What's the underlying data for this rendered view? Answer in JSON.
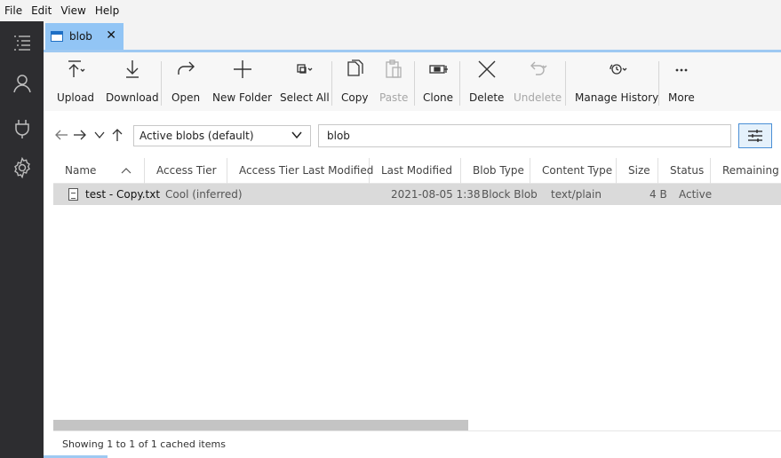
{
  "menu": [
    "File",
    "Edit",
    "View",
    "Help"
  ],
  "activity_bar": {
    "items": [
      {
        "icon": "explorer-list-icon"
      },
      {
        "icon": "account-icon"
      },
      {
        "icon": "connect-plug-icon"
      },
      {
        "icon": "settings-gear-icon"
      }
    ]
  },
  "tab": {
    "label": "blob",
    "close": "✕"
  },
  "toolbar": {
    "upload": "Upload",
    "download": "Download",
    "open": "Open",
    "new_folder": "New Folder",
    "select_all": "Select All",
    "copy": "Copy",
    "paste": "Paste",
    "clone": "Clone",
    "delete": "Delete",
    "undelete": "Undelete",
    "manage_history": "Manage History",
    "more": "More"
  },
  "nav": {
    "view_selected": "Active blobs (default)",
    "path": "blob"
  },
  "grid": {
    "columns": [
      "Name",
      "Access Tier",
      "Access Tier Last Modified",
      "Last Modified",
      "Blob Type",
      "Content Type",
      "Size",
      "Status",
      "Remaining D"
    ],
    "rows": [
      {
        "name": "test - Copy.txt",
        "access_tier": "Cool (inferred)",
        "access_tier_last_modified": "",
        "last_modified": "2021-08-05 1:38",
        "blob_type": "Block Blob",
        "content_type": "text/plain",
        "size": "4 B",
        "status": "Active"
      }
    ]
  },
  "status": {
    "text": "Showing 1 to 1 of 1 cached items"
  },
  "colors": {
    "activity_bar": "#2d2d30",
    "tab_active": "#92c5f5",
    "accent": "#4a8fd6",
    "selected_row": "#dadada"
  }
}
